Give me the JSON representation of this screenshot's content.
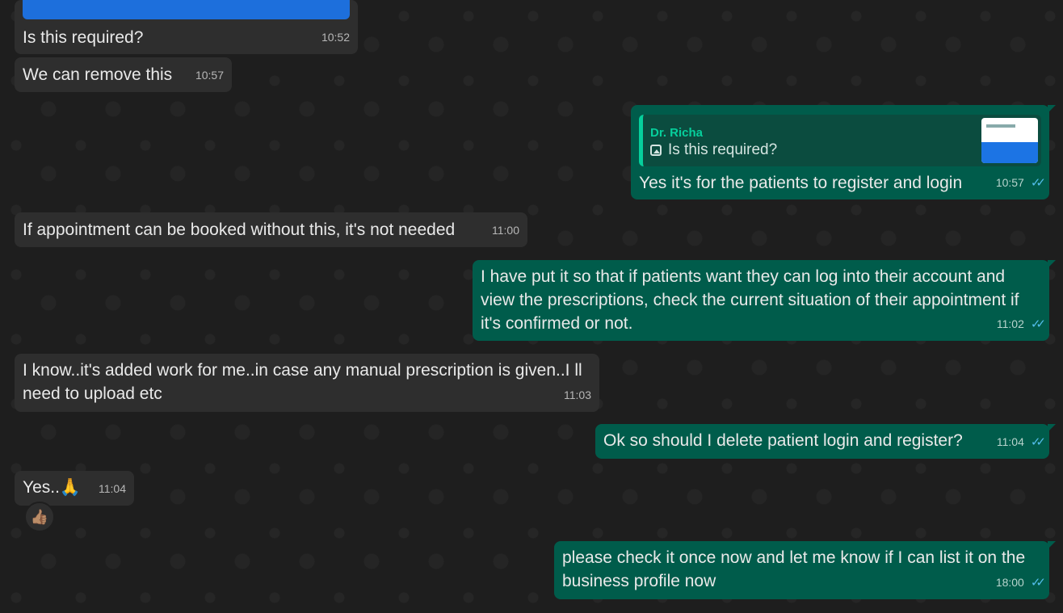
{
  "messages": [
    {
      "id": "m1",
      "dir": "in",
      "text": "Is this required?",
      "time": "10:52"
    },
    {
      "id": "m2",
      "dir": "in",
      "text": "We can remove this",
      "time": "10:57"
    },
    {
      "id": "m3",
      "dir": "out",
      "text": "Yes it's for the patients to register and login",
      "time": "10:57",
      "reply": {
        "author": "Dr. Richa",
        "text": "Is this required?"
      }
    },
    {
      "id": "m4",
      "dir": "in",
      "text": "If appointment can be booked without this, it's not needed",
      "time": "11:00"
    },
    {
      "id": "m5",
      "dir": "out",
      "text": "I have put it so that if patients want they can log into their account and view the prescriptions, check the current situation of their appointment if it's confirmed or not.",
      "time": "11:02"
    },
    {
      "id": "m6",
      "dir": "in",
      "text": "I know..it's added work for me..in case any manual prescription is given..I ll need to upload etc",
      "time": "11:03"
    },
    {
      "id": "m7",
      "dir": "out",
      "text": "Ok so should I delete patient login and register?",
      "time": "11:04"
    },
    {
      "id": "m8",
      "dir": "in",
      "text": "Yes..🙏",
      "time": "11:04",
      "reaction": "👍🏽"
    },
    {
      "id": "m9",
      "dir": "out",
      "text": "please check it once now and let me know if I can list it on the business profile now",
      "time": "18:00"
    }
  ],
  "ticks": "✓✓",
  "colors": {
    "background": "#1e1e1e",
    "incoming": "#2e2e2e",
    "outgoing": "#005c4b",
    "read_ticks": "#53bdeb",
    "reply_author": "#06cf9c"
  }
}
